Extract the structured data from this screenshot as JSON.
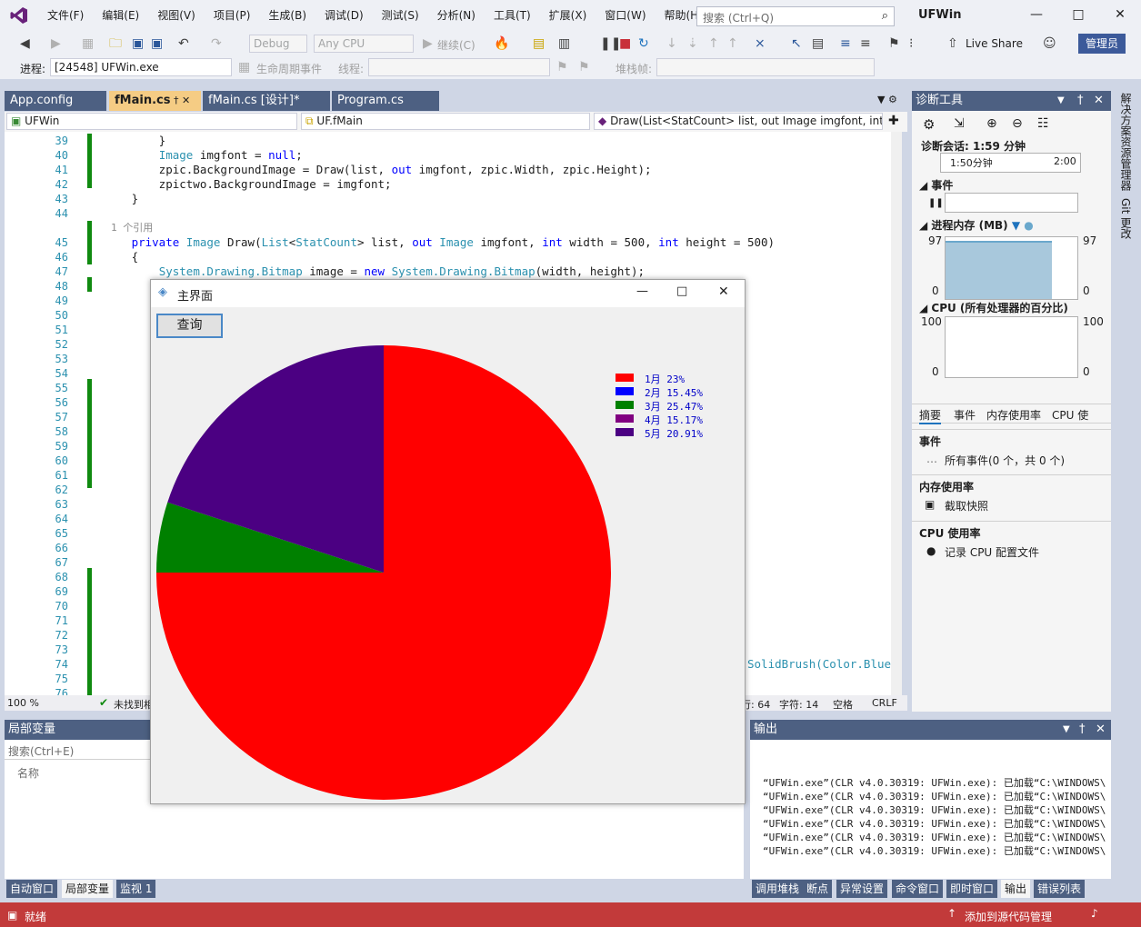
{
  "menu": {
    "items": [
      "文件(F)",
      "编辑(E)",
      "视图(V)",
      "项目(P)",
      "生成(B)",
      "调试(D)",
      "测试(S)",
      "分析(N)",
      "工具(T)",
      "扩展(X)",
      "窗口(W)",
      "帮助(H)"
    ],
    "search_placeholder": "搜索 (Ctrl+Q)",
    "app_title": "UFWin"
  },
  "toolbar": {
    "config": "Debug",
    "platform": "Any CPU",
    "continue": "继续(C)",
    "live_share": "Live Share",
    "admin": "管理员",
    "process_label": "进程:",
    "process_value": "[24548] UFWin.exe",
    "lifecycle": "生命周期事件",
    "thread_label": "线程:",
    "stack_label": "堆栈帧:"
  },
  "tabs": {
    "items": [
      {
        "label": "App.config",
        "active": false
      },
      {
        "label": "fMain.cs",
        "active": true
      },
      {
        "label": "fMain.cs [设计]*",
        "active": false
      },
      {
        "label": "Program.cs",
        "active": false
      }
    ]
  },
  "navbar": {
    "project": "UFWin",
    "class": "UF.fMain",
    "member": "Draw(List<StatCount> list, out Image imgfont, int"
  },
  "editor": {
    "line_numbers": [
      "39",
      "40",
      "41",
      "42",
      "43",
      "44",
      "",
      "45",
      "46",
      "47",
      "48",
      "49",
      "50",
      "51",
      "52",
      "53",
      "54",
      "55",
      "56",
      "57",
      "58",
      "59",
      "60",
      "61",
      "62",
      "63",
      "64",
      "65",
      "66",
      "67",
      "68",
      "69",
      "70",
      "71",
      "72",
      "73",
      "74",
      "75",
      "76"
    ],
    "codelens": "1 个引用",
    "code_tail": "SolidBrush(Color.Blue)",
    "zoom": "100 %",
    "issues": "未找到相",
    "col": "字符: 14",
    "line_pos": "行: 64",
    "spaces": "空格",
    "eol": "CRLF"
  },
  "diag": {
    "title": "诊断工具",
    "session": "诊断会话: 1:59 分钟",
    "timeline_a": "1:50分钟",
    "timeline_b": "2:00",
    "events_head": "事件",
    "mem_head": "进程内存 (MB)",
    "mem_max": "97",
    "mem_min": "0",
    "cpu_head": "CPU (所有处理器的百分比)",
    "cpu_max": "100",
    "cpu_min": "0",
    "tabs": [
      "摘要",
      "事件",
      "内存使用率",
      "CPU 使"
    ],
    "events_section": "事件",
    "all_events": "所有事件(0 个，共 0 个)",
    "mem_section": "内存使用率",
    "snapshot": "截取快照",
    "cpu_section": "CPU 使用率",
    "record_cpu": "记录 CPU 配置文件"
  },
  "right_rail": {
    "solution_explorer": "解决方案资源管理器",
    "git": "Git 更改"
  },
  "locals": {
    "title": "局部变量",
    "search_placeholder": "搜索(Ctrl+E)",
    "name_col": "名称"
  },
  "output": {
    "title": "输出",
    "lines": [
      "“UFWin.exe”(CLR v4.0.30319: UFWin.exe): 已加载“C:\\WINDOWS\\",
      "“UFWin.exe”(CLR v4.0.30319: UFWin.exe): 已加载“C:\\WINDOWS\\",
      "“UFWin.exe”(CLR v4.0.30319: UFWin.exe): 已加载“C:\\WINDOWS\\",
      "“UFWin.exe”(CLR v4.0.30319: UFWin.exe): 已加载“C:\\WINDOWS\\",
      "“UFWin.exe”(CLR v4.0.30319: UFWin.exe): 已加载“C:\\WINDOWS\\",
      "“UFWin.exe”(CLR v4.0.30319: UFWin.exe): 已加载“C:\\WINDOWS\\"
    ]
  },
  "bottom_tabs_left": [
    {
      "label": "自动窗口",
      "active": false
    },
    {
      "label": "局部变量",
      "active": true
    },
    {
      "label": "监视 1",
      "active": false
    }
  ],
  "bottom_tabs_right": [
    {
      "label": "调用堆栈",
      "active": false
    },
    {
      "label": "断点",
      "active": false
    },
    {
      "label": "异常设置",
      "active": false
    },
    {
      "label": "命令窗口",
      "active": false
    },
    {
      "label": "即时窗口",
      "active": false
    },
    {
      "label": "输出",
      "active": true
    },
    {
      "label": "错误列表",
      "active": false
    }
  ],
  "statusbar": {
    "ready": "就绪",
    "source_control": "添加到源代码管理"
  },
  "form": {
    "title": "主界面",
    "query_button": "查询",
    "legend": [
      {
        "label": "1月 23%",
        "color": "#ff0000"
      },
      {
        "label": "2月 15.45%",
        "color": "#0000ff"
      },
      {
        "label": "3月 25.47%",
        "color": "#008000"
      },
      {
        "label": "4月 15.17%",
        "color": "#800080"
      },
      {
        "label": "5月 20.91%",
        "color": "#4b0082"
      }
    ],
    "pie_slices": [
      {
        "label": "1月",
        "value": 75,
        "color": "#ff0000"
      },
      {
        "label": "3月",
        "value": 5,
        "color": "#008000"
      },
      {
        "label": "5月",
        "value": 20,
        "color": "#4b0082"
      }
    ]
  }
}
